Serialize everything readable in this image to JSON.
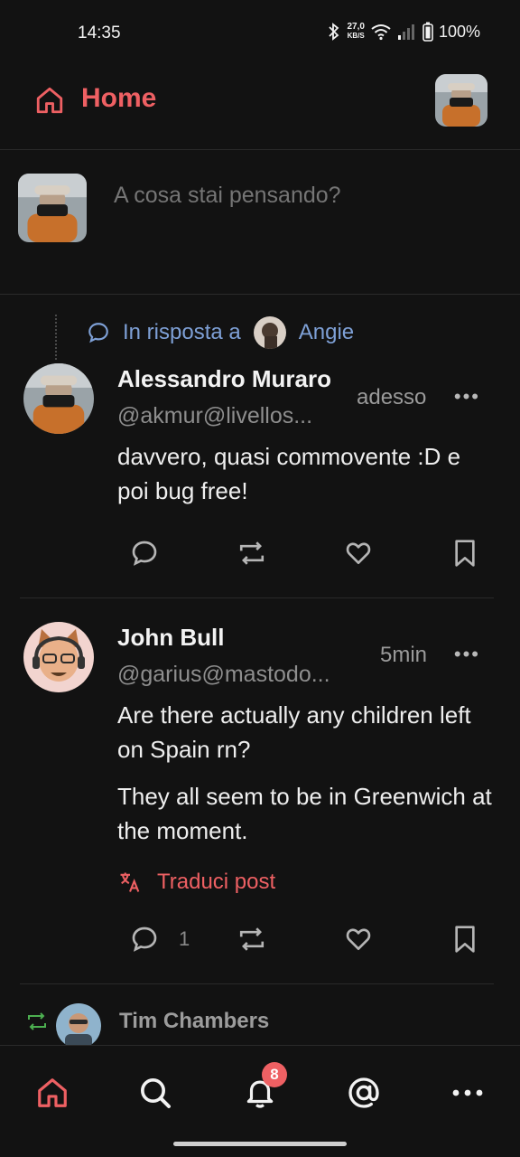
{
  "status_bar": {
    "time": "14:35",
    "speed_value": "27,0",
    "speed_unit": "KB/S",
    "battery": "100%"
  },
  "header": {
    "title": "Home"
  },
  "compose": {
    "placeholder": "A cosa stai pensando?"
  },
  "posts": [
    {
      "reply_prefix": "In risposta a",
      "reply_user": "Angie",
      "author": "Alessandro Muraro",
      "handle": "@akmur@livellos...",
      "time": "adesso",
      "content": [
        "davvero, quasi commovente :D e poi bug free!"
      ],
      "reply_count": ""
    },
    {
      "author": "John Bull",
      "handle": "@garius@mastodo...",
      "time": "5min",
      "content": [
        "Are there actually any children left on Spain rn?",
        "They all seem to be in Greenwich at the moment."
      ],
      "translate_label": "Traduci post",
      "reply_count": "1"
    }
  ],
  "boost": {
    "name": "Tim Chambers"
  },
  "bottom_nav": {
    "notifications_badge": "8"
  },
  "more_label": "•••",
  "colors": {
    "accent": "#ee6063",
    "link": "#7ea0d6",
    "boost": "#4caf50",
    "background": "#121212"
  }
}
